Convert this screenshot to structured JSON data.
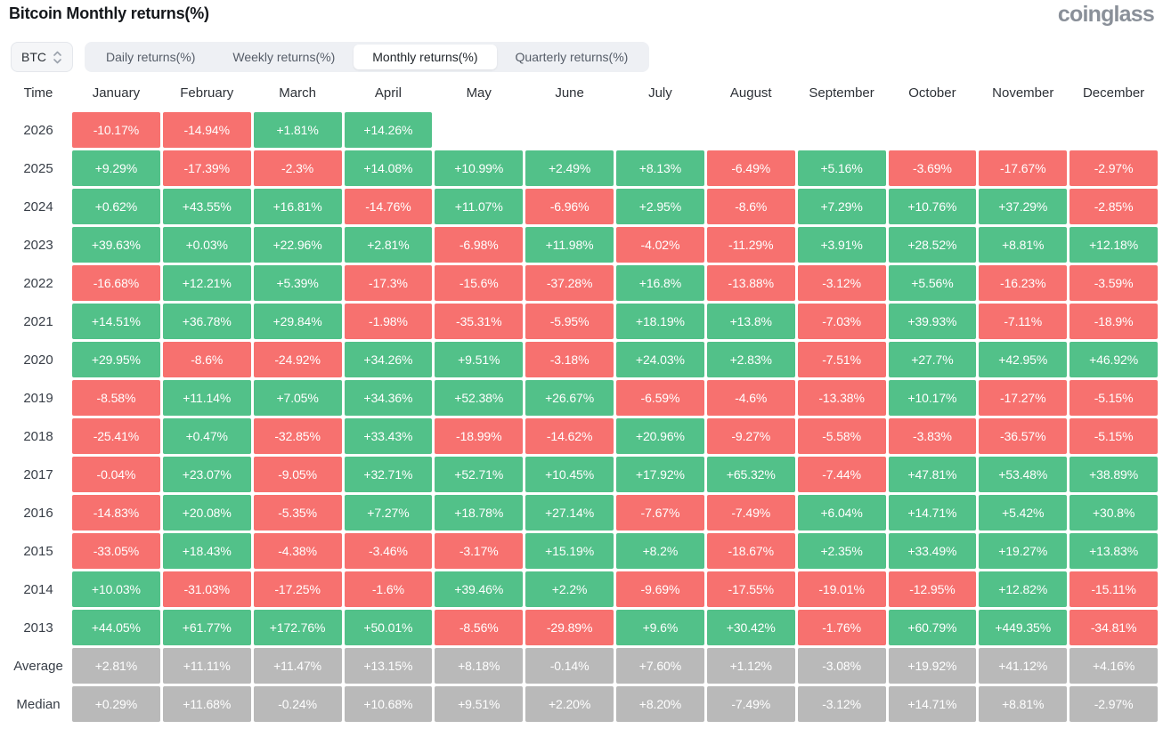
{
  "page": {
    "title": "Bitcoin Monthly returns(%)",
    "logo_text": "coinglass"
  },
  "controls": {
    "symbol_select": {
      "value": "BTC",
      "icon": "sort-chevrons-icon"
    },
    "tabs": [
      {
        "key": "daily-returns",
        "label": "Daily returns(%)",
        "active": false
      },
      {
        "key": "weekly-returns",
        "label": "Weekly returns(%)",
        "active": false
      },
      {
        "key": "monthly-returns",
        "label": "Monthly returns(%)",
        "active": true
      },
      {
        "key": "quarterly-returns",
        "label": "Quarterly returns(%)",
        "active": false
      }
    ]
  },
  "colors": {
    "positive": "#52c189",
    "negative": "#f7716f",
    "neutral": "#b9b9b9"
  },
  "chart_data": {
    "type": "heatmap",
    "title": "Bitcoin Monthly returns(%)",
    "time_label": "Time",
    "months": [
      "January",
      "February",
      "March",
      "April",
      "May",
      "June",
      "July",
      "August",
      "September",
      "October",
      "November",
      "December"
    ],
    "rows": [
      {
        "label": "2026",
        "summary": false,
        "values": [
          "-10.17%",
          "-14.94%",
          "+1.81%",
          "+14.26%",
          null,
          null,
          null,
          null,
          null,
          null,
          null,
          null
        ]
      },
      {
        "label": "2025",
        "summary": false,
        "values": [
          "+9.29%",
          "-17.39%",
          "-2.3%",
          "+14.08%",
          "+10.99%",
          "+2.49%",
          "+8.13%",
          "-6.49%",
          "+5.16%",
          "-3.69%",
          "-17.67%",
          "-2.97%"
        ]
      },
      {
        "label": "2024",
        "summary": false,
        "values": [
          "+0.62%",
          "+43.55%",
          "+16.81%",
          "-14.76%",
          "+11.07%",
          "-6.96%",
          "+2.95%",
          "-8.6%",
          "+7.29%",
          "+10.76%",
          "+37.29%",
          "-2.85%"
        ]
      },
      {
        "label": "2023",
        "summary": false,
        "values": [
          "+39.63%",
          "+0.03%",
          "+22.96%",
          "+2.81%",
          "-6.98%",
          "+11.98%",
          "-4.02%",
          "-11.29%",
          "+3.91%",
          "+28.52%",
          "+8.81%",
          "+12.18%"
        ]
      },
      {
        "label": "2022",
        "summary": false,
        "values": [
          "-16.68%",
          "+12.21%",
          "+5.39%",
          "-17.3%",
          "-15.6%",
          "-37.28%",
          "+16.8%",
          "-13.88%",
          "-3.12%",
          "+5.56%",
          "-16.23%",
          "-3.59%"
        ]
      },
      {
        "label": "2021",
        "summary": false,
        "values": [
          "+14.51%",
          "+36.78%",
          "+29.84%",
          "-1.98%",
          "-35.31%",
          "-5.95%",
          "+18.19%",
          "+13.8%",
          "-7.03%",
          "+39.93%",
          "-7.11%",
          "-18.9%"
        ]
      },
      {
        "label": "2020",
        "summary": false,
        "values": [
          "+29.95%",
          "-8.6%",
          "-24.92%",
          "+34.26%",
          "+9.51%",
          "-3.18%",
          "+24.03%",
          "+2.83%",
          "-7.51%",
          "+27.7%",
          "+42.95%",
          "+46.92%"
        ]
      },
      {
        "label": "2019",
        "summary": false,
        "values": [
          "-8.58%",
          "+11.14%",
          "+7.05%",
          "+34.36%",
          "+52.38%",
          "+26.67%",
          "-6.59%",
          "-4.6%",
          "-13.38%",
          "+10.17%",
          "-17.27%",
          "-5.15%"
        ]
      },
      {
        "label": "2018",
        "summary": false,
        "values": [
          "-25.41%",
          "+0.47%",
          "-32.85%",
          "+33.43%",
          "-18.99%",
          "-14.62%",
          "+20.96%",
          "-9.27%",
          "-5.58%",
          "-3.83%",
          "-36.57%",
          "-5.15%"
        ]
      },
      {
        "label": "2017",
        "summary": false,
        "values": [
          "-0.04%",
          "+23.07%",
          "-9.05%",
          "+32.71%",
          "+52.71%",
          "+10.45%",
          "+17.92%",
          "+65.32%",
          "-7.44%",
          "+47.81%",
          "+53.48%",
          "+38.89%"
        ]
      },
      {
        "label": "2016",
        "summary": false,
        "values": [
          "-14.83%",
          "+20.08%",
          "-5.35%",
          "+7.27%",
          "+18.78%",
          "+27.14%",
          "-7.67%",
          "-7.49%",
          "+6.04%",
          "+14.71%",
          "+5.42%",
          "+30.8%"
        ]
      },
      {
        "label": "2015",
        "summary": false,
        "values": [
          "-33.05%",
          "+18.43%",
          "-4.38%",
          "-3.46%",
          "-3.17%",
          "+15.19%",
          "+8.2%",
          "-18.67%",
          "+2.35%",
          "+33.49%",
          "+19.27%",
          "+13.83%"
        ]
      },
      {
        "label": "2014",
        "summary": false,
        "values": [
          "+10.03%",
          "-31.03%",
          "-17.25%",
          "-1.6%",
          "+39.46%",
          "+2.2%",
          "-9.69%",
          "-17.55%",
          "-19.01%",
          "-12.95%",
          "+12.82%",
          "-15.11%"
        ]
      },
      {
        "label": "2013",
        "summary": false,
        "values": [
          "+44.05%",
          "+61.77%",
          "+172.76%",
          "+50.01%",
          "-8.56%",
          "-29.89%",
          "+9.6%",
          "+30.42%",
          "-1.76%",
          "+60.79%",
          "+449.35%",
          "-34.81%"
        ]
      },
      {
        "label": "Average",
        "summary": true,
        "values": [
          "+2.81%",
          "+11.11%",
          "+11.47%",
          "+13.15%",
          "+8.18%",
          "-0.14%",
          "+7.60%",
          "+1.12%",
          "-3.08%",
          "+19.92%",
          "+41.12%",
          "+4.16%"
        ]
      },
      {
        "label": "Median",
        "summary": true,
        "values": [
          "+0.29%",
          "+11.68%",
          "-0.24%",
          "+10.68%",
          "+9.51%",
          "+2.20%",
          "+8.20%",
          "-7.49%",
          "-3.12%",
          "+14.71%",
          "+8.81%",
          "-2.97%"
        ]
      }
    ]
  }
}
